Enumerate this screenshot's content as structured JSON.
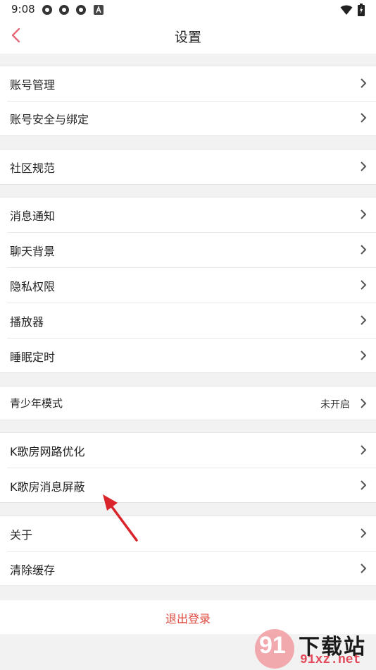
{
  "status_bar": {
    "time": "9:08",
    "notification_icons": [
      "app-icon",
      "app-icon",
      "app-icon",
      "a-icon"
    ],
    "right_icons": [
      "wifi-icon",
      "battery-icon"
    ]
  },
  "header": {
    "title": "设置",
    "back_icon": "chevron-left-icon"
  },
  "groups": [
    {
      "items": [
        {
          "label": "账号管理"
        },
        {
          "label": "账号安全与绑定"
        }
      ]
    },
    {
      "items": [
        {
          "label": "社区规范"
        }
      ]
    },
    {
      "items": [
        {
          "label": "消息通知"
        },
        {
          "label": "聊天背景"
        },
        {
          "label": "隐私权限"
        },
        {
          "label": "播放器"
        },
        {
          "label": "睡眠定时"
        }
      ]
    },
    {
      "items": [
        {
          "label": "青少年模式",
          "value": "未开启"
        }
      ]
    },
    {
      "items": [
        {
          "label": "K歌房网路优化"
        },
        {
          "label": "K歌房消息屏蔽"
        }
      ]
    },
    {
      "items": [
        {
          "label": "关于"
        },
        {
          "label": "清除缓存"
        }
      ]
    }
  ],
  "logout": {
    "label": "退出登录"
  },
  "watermark": {
    "number": "91",
    "title": "下载站",
    "url": "91xz.net"
  },
  "colors": {
    "accent": "#e0483e",
    "back_icon": "#e46a78",
    "annotation_arrow": "#d9242b",
    "background": "#f2f2f2"
  }
}
